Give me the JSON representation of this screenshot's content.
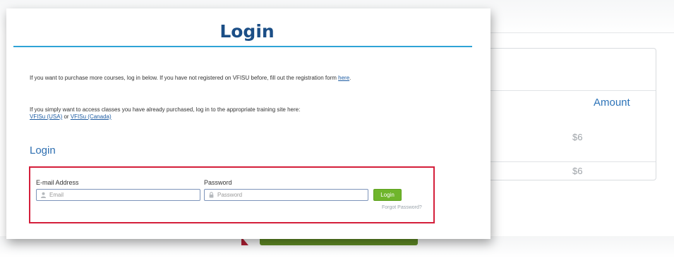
{
  "login_page": {
    "title": "Login",
    "intro_text": "If you want to purchase more courses, log in below. If you have not registered on VFISU before, fill out the registration form",
    "intro_link": "here",
    "intro_end": ".",
    "access_text": "If you simply want to access classes you have already purchased, log in to the appropriate training site here:",
    "usa_link": "VFISu (USA)",
    "or_text": "or",
    "canada_link": "VFISu (Canada)",
    "section_heading": "Login",
    "email_label": "E-mail Address",
    "email_placeholder": "Email",
    "password_label": "Password",
    "password_placeholder": "Password",
    "login_button": "Login",
    "forgot_password": "Forgot Password?"
  },
  "background_table": {
    "amount_header": "Amount",
    "rows": [
      "$6",
      "$6"
    ]
  },
  "colors": {
    "title": "#1b4e86",
    "rule": "#2fa3d6",
    "highlight": "#d41e3a",
    "button": "#6fb52b",
    "link": "#1f5da3"
  },
  "icons": {
    "email": "user-icon",
    "password": "lock-icon"
  }
}
